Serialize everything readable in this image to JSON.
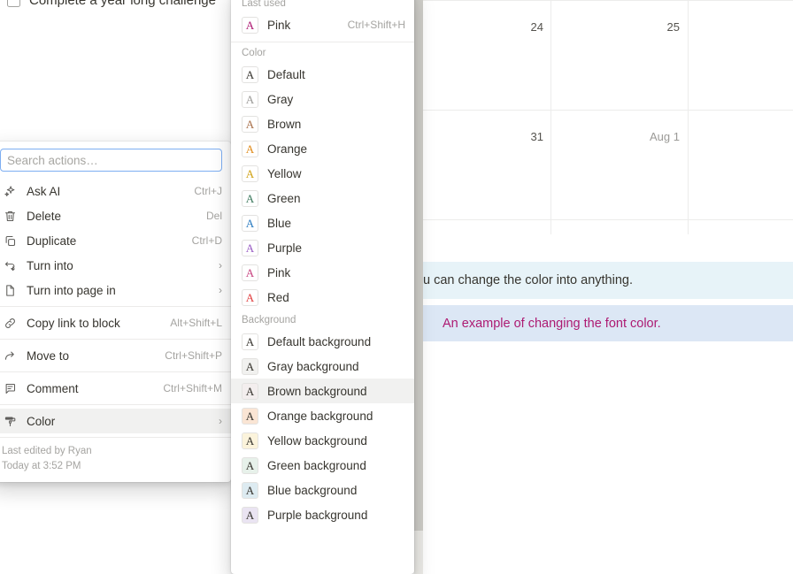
{
  "page": {
    "todo": {
      "label": "Complete a year long challenge",
      "checked": false
    },
    "calendar": {
      "days": [
        {
          "label": "24",
          "muted": false,
          "col": 1,
          "row": 1
        },
        {
          "label": "25",
          "muted": false,
          "col": 2,
          "row": 1
        },
        {
          "label": "31",
          "muted": false,
          "col": 1,
          "row": 2
        },
        {
          "label": "Aug 1",
          "muted": true,
          "col": 2,
          "row": 2
        }
      ]
    },
    "callouts": [
      {
        "text": "u can change the color into anything.",
        "bg": "#e7f3f8",
        "fg": "#37352f"
      },
      {
        "text": "An example of changing the font color.",
        "bg": "#dce7f5",
        "fg": "#ad1a72"
      }
    ]
  },
  "action_menu": {
    "search": {
      "placeholder": "Search actions…",
      "value": ""
    },
    "groups": [
      {
        "items": [
          {
            "icon": "sparkle-icon",
            "label": "Ask AI",
            "hint": "Ctrl+J",
            "chevron": false,
            "selected": false
          },
          {
            "icon": "trash-icon",
            "label": "Delete",
            "hint": "Del",
            "chevron": false,
            "selected": false
          },
          {
            "icon": "duplicate-icon",
            "label": "Duplicate",
            "hint": "Ctrl+D",
            "chevron": false,
            "selected": false
          },
          {
            "icon": "turn-into-icon",
            "label": "Turn into",
            "hint": "",
            "chevron": true,
            "selected": false
          },
          {
            "icon": "page-icon",
            "label": "Turn into page in",
            "hint": "",
            "chevron": true,
            "selected": false
          }
        ]
      },
      {
        "items": [
          {
            "icon": "link-icon",
            "label": "Copy link to block",
            "hint": "Alt+Shift+L",
            "chevron": false,
            "selected": false
          }
        ]
      },
      {
        "items": [
          {
            "icon": "arrow-move-icon",
            "label": "Move to",
            "hint": "Ctrl+Shift+P",
            "chevron": false,
            "selected": false
          }
        ]
      },
      {
        "items": [
          {
            "icon": "comment-icon",
            "label": "Comment",
            "hint": "Ctrl+Shift+M",
            "chevron": false,
            "selected": false
          }
        ]
      },
      {
        "items": [
          {
            "icon": "paint-roller-icon",
            "label": "Color",
            "hint": "",
            "chevron": true,
            "selected": true
          }
        ]
      }
    ],
    "footer": {
      "edited_by": "Last edited by Ryan",
      "edited_at": "Today at 3:52 PM"
    }
  },
  "color_menu": {
    "sections": [
      {
        "label": "Last used",
        "separator_after": true,
        "items": [
          {
            "label": "Pink",
            "hint": "Ctrl+Shift+H",
            "glyph": "A",
            "fg": "#ad1a72",
            "bg": "#ffffff",
            "selected": false
          }
        ]
      },
      {
        "label": "Color",
        "separator_after": false,
        "items": [
          {
            "label": "Default",
            "hint": "",
            "glyph": "A",
            "fg": "#37352f",
            "bg": "#ffffff",
            "selected": false
          },
          {
            "label": "Gray",
            "hint": "",
            "glyph": "A",
            "fg": "#9b9a97",
            "bg": "#ffffff",
            "selected": false
          },
          {
            "label": "Brown",
            "hint": "",
            "glyph": "A",
            "fg": "#a8714b",
            "bg": "#ffffff",
            "selected": false
          },
          {
            "label": "Orange",
            "hint": "",
            "glyph": "A",
            "fg": "#e08b1a",
            "bg": "#ffffff",
            "selected": false
          },
          {
            "label": "Yellow",
            "hint": "",
            "glyph": "A",
            "fg": "#d0a215",
            "bg": "#ffffff",
            "selected": false
          },
          {
            "label": "Green",
            "hint": "",
            "glyph": "A",
            "fg": "#3e7a5e",
            "bg": "#ffffff",
            "selected": false
          },
          {
            "label": "Blue",
            "hint": "",
            "glyph": "A",
            "fg": "#2a7bc0",
            "bg": "#ffffff",
            "selected": false
          },
          {
            "label": "Purple",
            "hint": "",
            "glyph": "A",
            "fg": "#9a5dc4",
            "bg": "#ffffff",
            "selected": false
          },
          {
            "label": "Pink",
            "hint": "",
            "glyph": "A",
            "fg": "#c7437f",
            "bg": "#ffffff",
            "selected": false
          },
          {
            "label": "Red",
            "hint": "",
            "glyph": "A",
            "fg": "#e03e3e",
            "bg": "#ffffff",
            "selected": false
          }
        ]
      },
      {
        "label": "Background",
        "separator_after": false,
        "items": [
          {
            "label": "Default background",
            "hint": "",
            "glyph": "A",
            "fg": "#37352f",
            "bg": "#ffffff",
            "selected": false
          },
          {
            "label": "Gray background",
            "hint": "",
            "glyph": "A",
            "fg": "#37352f",
            "bg": "#f1f1ef",
            "selected": false
          },
          {
            "label": "Brown background",
            "hint": "",
            "glyph": "A",
            "fg": "#37352f",
            "bg": "#f3eeee",
            "selected": true
          },
          {
            "label": "Orange background",
            "hint": "",
            "glyph": "A",
            "fg": "#37352f",
            "bg": "#fae5d4",
            "selected": false
          },
          {
            "label": "Yellow background",
            "hint": "",
            "glyph": "A",
            "fg": "#37352f",
            "bg": "#fbf3db",
            "selected": false
          },
          {
            "label": "Green background",
            "hint": "",
            "glyph": "A",
            "fg": "#37352f",
            "bg": "#e7f1ea",
            "selected": false
          },
          {
            "label": "Blue background",
            "hint": "",
            "glyph": "A",
            "fg": "#37352f",
            "bg": "#ddebf1",
            "selected": false
          },
          {
            "label": "Purple background",
            "hint": "",
            "glyph": "A",
            "fg": "#37352f",
            "bg": "#eae4f2",
            "selected": false
          }
        ]
      }
    ]
  },
  "colors": {
    "accent_focus": "#7daef2",
    "hover_row": "#f1f1f0",
    "text_primary": "#37352f",
    "text_muted": "#a5a4a1"
  }
}
